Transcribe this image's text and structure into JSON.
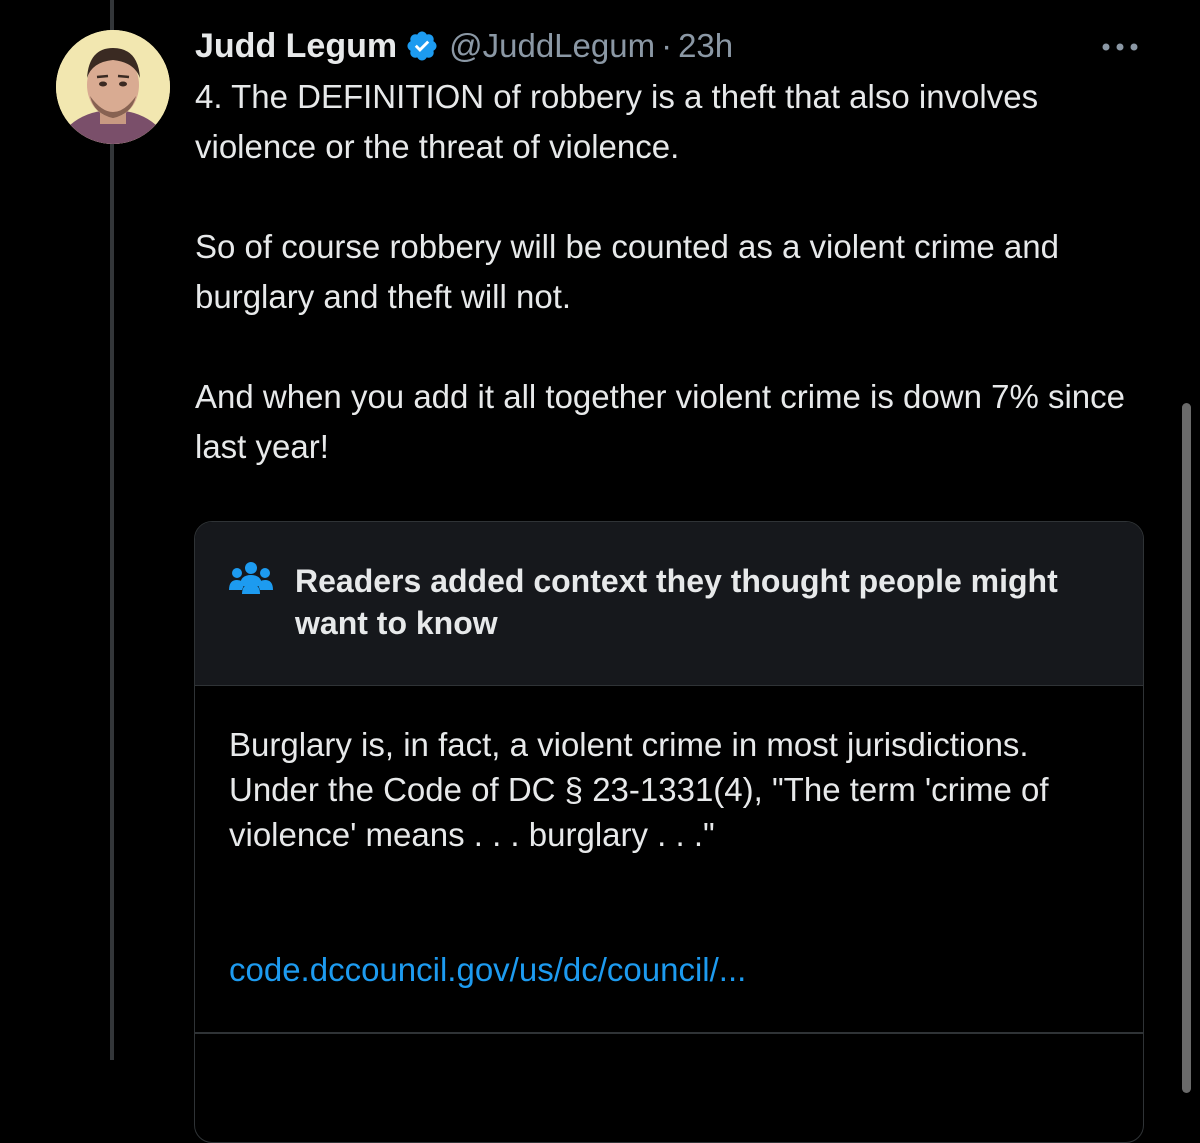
{
  "tweet": {
    "author_name": "Judd Legum",
    "handle": "@JuddLegum",
    "separator": "·",
    "time": "23h",
    "verified_icon": "verified-badge-icon",
    "verified_color": "#1d9bf0",
    "more_icon": "more-options-icon",
    "paragraphs": [
      "4. The DEFINITION of robbery is a theft that also involves violence or the threat of violence.",
      "So of course robbery will be counted as a violent crime and burglary and theft will not.",
      "And when you add it all together violent crime is down 7% since last year!"
    ]
  },
  "community_note": {
    "icon": "people-group-icon",
    "icon_color": "#1d9bf0",
    "title": "Readers added context they thought people might want to know",
    "text": "Burglary is, in fact, a violent crime in most jurisdictions. Under the Code of DC § 23-1331(4), \"The term 'crime of violence' means . . . burglary . . .\"",
    "link": "code.dccouncil.gov/us/dc/council/...",
    "link_color": "#1d9bf0"
  },
  "colors": {
    "background": "#000000",
    "text": "#e7e9ea",
    "secondary_text": "#8b98a5",
    "border": "#2f3336",
    "note_header_bg": "#16181c"
  }
}
